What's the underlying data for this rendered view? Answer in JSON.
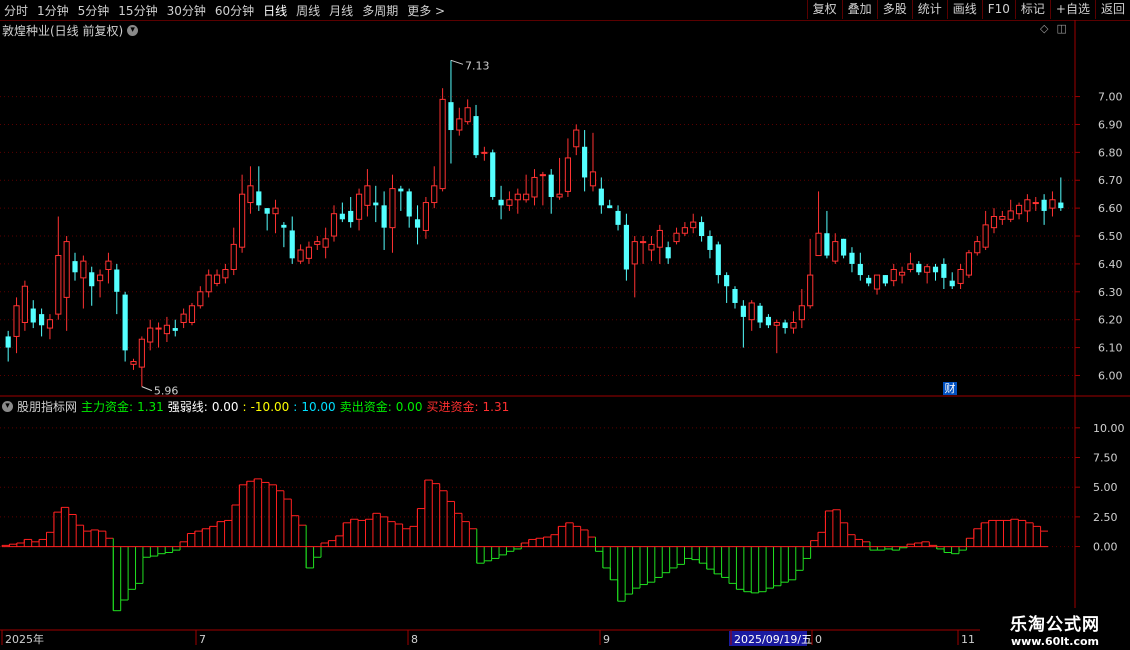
{
  "toolbar": {
    "periods": [
      "分时",
      "1分钟",
      "5分钟",
      "15分钟",
      "30分钟",
      "60分钟",
      "日线",
      "周线",
      "月线",
      "多周期",
      "更多 >"
    ],
    "active_period": "日线",
    "right_buttons": [
      "复权",
      "叠加",
      "多股",
      "统计",
      "画线",
      "F10",
      "标记",
      "+自选",
      "返回"
    ]
  },
  "chart_title": "敦煌种业(日线 前复权)",
  "title_icon": "chevron-down-icon",
  "indicator": {
    "name": "股朋指标网",
    "items": [
      {
        "label": "主力资金:",
        "value": "1.31",
        "color": "#00ee00"
      },
      {
        "label": "强弱线:",
        "value": "0.00",
        "color": "#ffffff"
      },
      {
        "label": ":",
        "value": "-10.00",
        "color": "#ffff00"
      },
      {
        "label": ":",
        "value": "10.00",
        "color": "#00e0ff"
      },
      {
        "label": "卖出资金:",
        "value": "0.00",
        "color": "#00ee00"
      },
      {
        "label": "买进资金:",
        "value": "1.31",
        "color": "#ff3030"
      }
    ]
  },
  "price_axis": [
    "7.00",
    "6.90",
    "6.80",
    "6.70",
    "6.60",
    "6.50",
    "6.40",
    "6.30",
    "6.20",
    "6.10",
    "6.00"
  ],
  "ind_axis": [
    "10.00",
    "7.50",
    "5.00",
    "2.50",
    "0.00"
  ],
  "date_axis": {
    "year": "2025年",
    "months": [
      "7",
      "8",
      "9",
      "0",
      "11"
    ],
    "cursor_date": "2025/09/19/五"
  },
  "annotations": {
    "high": "7.13",
    "low": "5.96",
    "cai": "财"
  },
  "colors": {
    "up": "#ff3232",
    "down": "#54ffff",
    "red": "#ff2020",
    "green": "#20e020",
    "axis": "#9e0000"
  },
  "watermark": {
    "line1": "乐淘公式网",
    "line2": "www.60lt.com"
  },
  "chart_data": [
    {
      "type": "candlestick",
      "title": "敦煌种业(日线 前复权)",
      "ylim": [
        5.93,
        7.21
      ],
      "y_ticks": [
        6.0,
        6.1,
        6.2,
        6.3,
        6.4,
        6.5,
        6.6,
        6.7,
        6.8,
        6.9,
        7.0
      ],
      "candles": [
        [
          6.14,
          6.1,
          6.16,
          6.05
        ],
        [
          6.14,
          6.25,
          6.28,
          6.08
        ],
        [
          6.19,
          6.32,
          6.34,
          6.16
        ],
        [
          6.24,
          6.19,
          6.27,
          6.17
        ],
        [
          6.22,
          6.18,
          6.24,
          6.14
        ],
        [
          6.17,
          6.2,
          6.22,
          6.13
        ],
        [
          6.22,
          6.43,
          6.57,
          6.2
        ],
        [
          6.28,
          6.48,
          6.5,
          6.16
        ],
        [
          6.41,
          6.37,
          6.44,
          6.34
        ],
        [
          6.35,
          6.41,
          6.43,
          6.24
        ],
        [
          6.37,
          6.32,
          6.39,
          6.25
        ],
        [
          6.34,
          6.36,
          6.38,
          6.28
        ],
        [
          6.38,
          6.41,
          6.44,
          6.33
        ],
        [
          6.38,
          6.3,
          6.4,
          6.22
        ],
        [
          6.29,
          6.09,
          6.3,
          6.05
        ],
        [
          6.04,
          6.05,
          6.06,
          6.02
        ],
        [
          6.03,
          6.13,
          6.14,
          5.96
        ],
        [
          6.12,
          6.17,
          6.2,
          6.09
        ],
        [
          6.17,
          6.17,
          6.19,
          6.1
        ],
        [
          6.15,
          6.18,
          6.21,
          6.12
        ],
        [
          6.17,
          6.16,
          6.2,
          6.14
        ],
        [
          6.19,
          6.22,
          6.24,
          6.17
        ],
        [
          6.19,
          6.25,
          6.26,
          6.18
        ],
        [
          6.25,
          6.3,
          6.32,
          6.24
        ],
        [
          6.3,
          6.36,
          6.38,
          6.28
        ],
        [
          6.33,
          6.36,
          6.38,
          6.32
        ],
        [
          6.35,
          6.38,
          6.4,
          6.33
        ],
        [
          6.38,
          6.47,
          6.53,
          6.36
        ],
        [
          6.46,
          6.65,
          6.72,
          6.44
        ],
        [
          6.62,
          6.68,
          6.75,
          6.58
        ],
        [
          6.66,
          6.61,
          6.75,
          6.59
        ],
        [
          6.6,
          6.58,
          6.6,
          6.52
        ],
        [
          6.58,
          6.6,
          6.63,
          6.51
        ],
        [
          6.54,
          6.53,
          6.55,
          6.46
        ],
        [
          6.52,
          6.42,
          6.57,
          6.4
        ],
        [
          6.41,
          6.45,
          6.47,
          6.4
        ],
        [
          6.42,
          6.46,
          6.48,
          6.4
        ],
        [
          6.47,
          6.48,
          6.5,
          6.45
        ],
        [
          6.46,
          6.49,
          6.53,
          6.42
        ],
        [
          6.5,
          6.58,
          6.61,
          6.48
        ],
        [
          6.58,
          6.56,
          6.62,
          6.55
        ],
        [
          6.59,
          6.55,
          6.64,
          6.53
        ],
        [
          6.56,
          6.65,
          6.67,
          6.52
        ],
        [
          6.61,
          6.68,
          6.74,
          6.57
        ],
        [
          6.62,
          6.61,
          6.68,
          6.55
        ],
        [
          6.61,
          6.53,
          6.66,
          6.45
        ],
        [
          6.53,
          6.67,
          6.72,
          6.44
        ],
        [
          6.67,
          6.66,
          6.68,
          6.59
        ],
        [
          6.66,
          6.57,
          6.67,
          6.53
        ],
        [
          6.56,
          6.53,
          6.61,
          6.47
        ],
        [
          6.52,
          6.62,
          6.64,
          6.49
        ],
        [
          6.62,
          6.68,
          6.75,
          6.6
        ],
        [
          6.67,
          6.99,
          7.03,
          6.66
        ],
        [
          6.98,
          6.88,
          7.13,
          6.76
        ],
        [
          6.88,
          6.92,
          6.96,
          6.86
        ],
        [
          6.91,
          6.96,
          6.99,
          6.9
        ],
        [
          6.93,
          6.79,
          6.97,
          6.78
        ],
        [
          6.8,
          6.8,
          6.82,
          6.77
        ],
        [
          6.8,
          6.64,
          6.81,
          6.63
        ],
        [
          6.63,
          6.61,
          6.68,
          6.56
        ],
        [
          6.61,
          6.63,
          6.66,
          6.59
        ],
        [
          6.63,
          6.65,
          6.67,
          6.58
        ],
        [
          6.63,
          6.65,
          6.72,
          6.62
        ],
        [
          6.64,
          6.71,
          6.74,
          6.61
        ],
        [
          6.72,
          6.72,
          6.73,
          6.61
        ],
        [
          6.72,
          6.64,
          6.74,
          6.58
        ],
        [
          6.64,
          6.65,
          6.78,
          6.63
        ],
        [
          6.66,
          6.78,
          6.85,
          6.64
        ],
        [
          6.82,
          6.88,
          6.9,
          6.79
        ],
        [
          6.82,
          6.71,
          6.88,
          6.66
        ],
        [
          6.68,
          6.73,
          6.87,
          6.66
        ],
        [
          6.67,
          6.61,
          6.71,
          6.58
        ],
        [
          6.61,
          6.6,
          6.63,
          6.6
        ],
        [
          6.59,
          6.54,
          6.61,
          6.52
        ],
        [
          6.54,
          6.38,
          6.58,
          6.34
        ],
        [
          6.4,
          6.48,
          6.5,
          6.28
        ],
        [
          6.48,
          6.48,
          6.5,
          6.4
        ],
        [
          6.45,
          6.47,
          6.5,
          6.41
        ],
        [
          6.46,
          6.52,
          6.54,
          6.4
        ],
        [
          6.46,
          6.42,
          6.48,
          6.4
        ],
        [
          6.48,
          6.51,
          6.53,
          6.47
        ],
        [
          6.51,
          6.53,
          6.55,
          6.5
        ],
        [
          6.53,
          6.55,
          6.58,
          6.51
        ],
        [
          6.55,
          6.5,
          6.57,
          6.48
        ],
        [
          6.5,
          6.45,
          6.52,
          6.42
        ],
        [
          6.47,
          6.36,
          6.48,
          6.33
        ],
        [
          6.36,
          6.32,
          6.37,
          6.26
        ],
        [
          6.31,
          6.26,
          6.32,
          6.24
        ],
        [
          6.25,
          6.21,
          6.27,
          6.1
        ],
        [
          6.2,
          6.26,
          6.27,
          6.16
        ],
        [
          6.25,
          6.19,
          6.26,
          6.17
        ],
        [
          6.21,
          6.18,
          6.22,
          6.17
        ],
        [
          6.18,
          6.19,
          6.2,
          6.08
        ],
        [
          6.19,
          6.17,
          6.2,
          6.15
        ],
        [
          6.17,
          6.19,
          6.23,
          6.15
        ],
        [
          6.2,
          6.25,
          6.31,
          6.17
        ],
        [
          6.25,
          6.36,
          6.49,
          6.24
        ],
        [
          6.43,
          6.51,
          6.66,
          6.45
        ],
        [
          6.51,
          6.43,
          6.59,
          6.42
        ],
        [
          6.41,
          6.48,
          6.51,
          6.4
        ],
        [
          6.49,
          6.43,
          6.49,
          6.42
        ],
        [
          6.44,
          6.4,
          6.46,
          6.37
        ],
        [
          6.4,
          6.36,
          6.44,
          6.34
        ],
        [
          6.35,
          6.33,
          6.36,
          6.32
        ],
        [
          6.31,
          6.36,
          6.36,
          6.29
        ],
        [
          6.36,
          6.33,
          6.36,
          6.32
        ],
        [
          6.34,
          6.38,
          6.4,
          6.32
        ],
        [
          6.36,
          6.37,
          6.39,
          6.33
        ],
        [
          6.38,
          6.4,
          6.44,
          6.37
        ],
        [
          6.4,
          6.37,
          6.41,
          6.36
        ],
        [
          6.37,
          6.39,
          6.4,
          6.33
        ],
        [
          6.39,
          6.37,
          6.4,
          6.34
        ],
        [
          6.4,
          6.35,
          6.42,
          6.31
        ],
        [
          6.34,
          6.32,
          6.37,
          6.31
        ],
        [
          6.33,
          6.38,
          6.4,
          6.31
        ],
        [
          6.36,
          6.44,
          6.45,
          6.35
        ],
        [
          6.44,
          6.48,
          6.5,
          6.43
        ],
        [
          6.46,
          6.54,
          6.59,
          6.45
        ],
        [
          6.53,
          6.57,
          6.6,
          6.51
        ],
        [
          6.56,
          6.57,
          6.59,
          6.54
        ],
        [
          6.56,
          6.59,
          6.63,
          6.55
        ],
        [
          6.58,
          6.61,
          6.62,
          6.56
        ],
        [
          6.59,
          6.63,
          6.65,
          6.55
        ],
        [
          6.62,
          6.62,
          6.64,
          6.59
        ],
        [
          6.63,
          6.59,
          6.65,
          6.54
        ],
        [
          6.6,
          6.63,
          6.66,
          6.57
        ],
        [
          6.62,
          6.6,
          6.71,
          6.59
        ]
      ]
    },
    {
      "type": "bar",
      "title": "股朋指标网",
      "ylim": [
        -4.5,
        11.5
      ],
      "y_ticks": [
        0,
        2.5,
        5,
        7.5,
        10
      ],
      "series": [
        {
          "name": "主力资金",
          "values": [
            0.1,
            0.2,
            0.3,
            0.6,
            0.4,
            0.6,
            1.2,
            2.9,
            3.3,
            2.7,
            1.8,
            1.3,
            1.4,
            1.3,
            0.7,
            -5.4,
            -4.5,
            -3.6,
            -3.1,
            -0.9,
            -0.8,
            -0.6,
            -0.5,
            -0.3,
            0.4,
            1.1,
            1.3,
            1.5,
            1.7,
            2.1,
            2.2,
            3.5,
            5.2,
            5.5,
            5.7,
            5.4,
            5.2,
            4.7,
            4.0,
            2.6,
            1.8,
            -1.8,
            -0.9,
            0.3,
            0.5,
            0.9,
            2.0,
            2.3,
            2.2,
            2.3,
            2.8,
            2.5,
            2.1,
            1.9,
            1.5,
            1.7,
            3.2,
            5.6,
            5.3,
            4.7,
            3.8,
            2.8,
            2.1,
            1.5,
            -1.4,
            -1.2,
            -1.0,
            -0.7,
            -0.4,
            -0.2,
            0.3,
            0.6,
            0.7,
            0.8,
            1.0,
            1.7,
            2.0,
            1.7,
            1.4,
            0.8,
            -0.4,
            -1.8,
            -2.8,
            -4.6,
            -4.0,
            -3.5,
            -3.2,
            -3.0,
            -2.6,
            -2.2,
            -1.8,
            -1.5,
            -1.0,
            -1.1,
            -1.4,
            -1.9,
            -2.3,
            -2.6,
            -3.1,
            -3.6,
            -3.8,
            -3.9,
            -3.8,
            -3.5,
            -3.3,
            -3.0,
            -2.8,
            -2.0,
            -1.0,
            0.5,
            1.2,
            3.0,
            3.1,
            2.0,
            1.0,
            0.6,
            0.4,
            -0.3,
            -0.3,
            -0.2,
            -0.3,
            -0.1,
            0.2,
            0.3,
            0.4,
            0.1,
            -0.2,
            -0.5,
            -0.6,
            -0.3,
            0.7,
            1.5,
            2.0,
            2.2,
            2.2,
            2.2,
            2.3,
            2.2,
            2.0,
            1.7,
            1.3
          ]
        }
      ]
    }
  ]
}
